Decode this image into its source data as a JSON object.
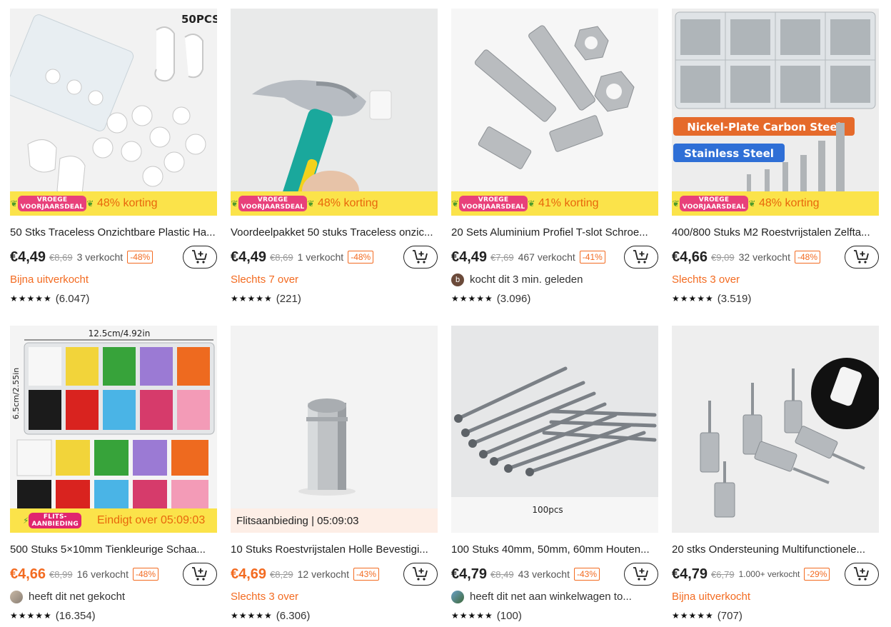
{
  "colors": {
    "accent": "#f36b21",
    "promo_bg": "#fbe34a",
    "flash_bg": "#fdeee6"
  },
  "products": [
    {
      "title": "50 Stks Traceless Onzichtbare Plastic Ha...",
      "price": "€4,49",
      "old_price": "€8,69",
      "sold": "3 verkocht",
      "discount": "-48%",
      "badge_logo": "VROEGE\nVOORJAARSDEAL",
      "badge_text": "48% korting",
      "image_label": "50PCS",
      "status": "Bijna uitverkocht",
      "stars": "★★★★★",
      "rating_count": "(6.047)"
    },
    {
      "title": "Voordeelpakket 50 stuks Traceless onzic...",
      "price": "€4,49",
      "old_price": "€8,69",
      "sold": "1 verkocht",
      "discount": "-48%",
      "badge_logo": "VROEGE\nVOORJAARSDEAL",
      "badge_text": "48% korting",
      "status": "Slechts 7 over",
      "stars": "★★★★★",
      "rating_count": "(221)"
    },
    {
      "title": "20 Sets Aluminium Profiel T-slot Schroe...",
      "price": "€4,49",
      "old_price": "€7,69",
      "sold": "467 verkocht",
      "discount": "-41%",
      "badge_logo": "VROEGE\nVOORJAARSDEAL",
      "badge_text": "41% korting",
      "buyer_initial": "b",
      "status": "kocht dit 3 min. geleden",
      "stars": "★★★★★",
      "rating_count": "(3.096)"
    },
    {
      "title": "400/800 Stuks M2 Roestvrijstalen Zelfta...",
      "price": "€4,66",
      "old_price": "€9,09",
      "sold": "32 verkocht",
      "discount": "-48%",
      "badge_logo": "VROEGE\nVOORJAARSDEAL",
      "badge_text": "48% korting",
      "image_label_1": "Nickel-Plate Carbon Steel",
      "image_label_2": "Stainless Steel",
      "status": "Slechts 3 over",
      "stars": "★★★★★",
      "rating_count": "(3.519)"
    },
    {
      "title": "500 Stuks 5×10mm Tienkleurige Schaa...",
      "price": "€4,66",
      "old_price": "€8,99",
      "sold": "16 verkocht",
      "discount": "-48%",
      "badge_logo": "FLITS-\nAANBIEDING",
      "badge_text": "Eindigt over 05:09:03",
      "image_label_1": "12.5cm/4.92in",
      "image_label_2": "6.5cm/2.55in",
      "status": "heeft dit net gekocht",
      "stars": "★★★★★",
      "rating_count": "(16.354)"
    },
    {
      "title": "10 Stuks Roestvrijstalen Holle Bevestigi...",
      "price": "€4,69",
      "old_price": "€8,29",
      "sold": "12 verkocht",
      "discount": "-43%",
      "badge_text": "Flitsaanbieding | 05:09:03",
      "status": "Slechts 3 over",
      "stars": "★★★★★",
      "rating_count": "(6.306)"
    },
    {
      "title": "100 Stuks 40mm, 50mm, 60mm Houten...",
      "price": "€4,79",
      "old_price": "€8,49",
      "sold": "43 verkocht",
      "discount": "-43%",
      "image_label": "100pcs",
      "status": "heeft dit net aan winkelwagen to...",
      "stars": "★★★★★",
      "rating_count": "(100)"
    },
    {
      "title": "20 stks Ondersteuning Multifunctionele...",
      "price": "€4,79",
      "old_price": "€6,79",
      "sold": "1.000+ verkocht",
      "discount": "-29%",
      "status": "Bijna uitverkocht",
      "stars": "★★★★★",
      "rating_count": "(707)"
    }
  ]
}
